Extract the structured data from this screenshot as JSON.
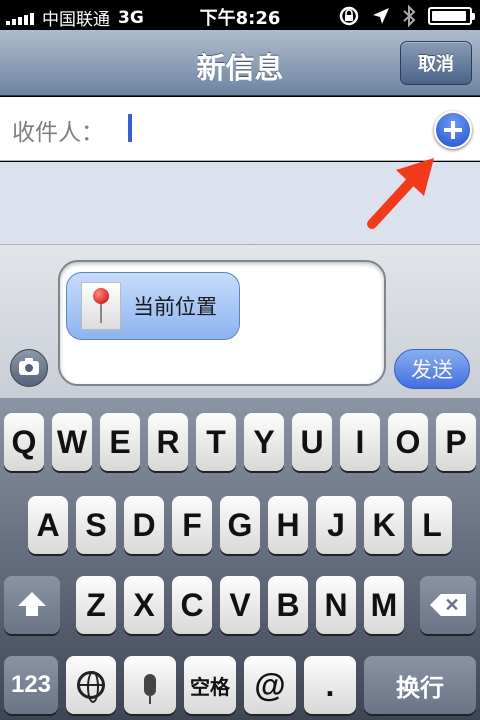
{
  "status_bar": {
    "carrier": "中国联通",
    "network": "3G",
    "time": "下午8:26",
    "icons": [
      "signal-icon",
      "rotation-lock-icon",
      "location-arrow-icon",
      "bluetooth-icon",
      "battery-icon"
    ],
    "battery_level": 0.95
  },
  "navbar": {
    "title": "新信息",
    "cancel_label": "取消"
  },
  "recipient": {
    "label": "收件人：",
    "value": "",
    "add_icon": "plus-circle-icon"
  },
  "compose": {
    "camera_icon": "camera-icon",
    "attachment_label": "当前位置",
    "attachment_icon": "map-pin-icon",
    "send_label": "发送"
  },
  "keyboard": {
    "row1": [
      "Q",
      "W",
      "E",
      "R",
      "T",
      "Y",
      "U",
      "I",
      "O",
      "P"
    ],
    "row2": [
      "A",
      "S",
      "D",
      "F",
      "G",
      "H",
      "J",
      "K",
      "L"
    ],
    "row3": [
      "Z",
      "X",
      "C",
      "V",
      "B",
      "N",
      "M"
    ],
    "numbers_label": "123",
    "space_label": "空格",
    "at_label": "@",
    "dot_label": ".",
    "return_label": "换行",
    "colors": {
      "key": "#ffffff",
      "special_key": "#6b7485",
      "accent": "#2c5fe0"
    }
  }
}
